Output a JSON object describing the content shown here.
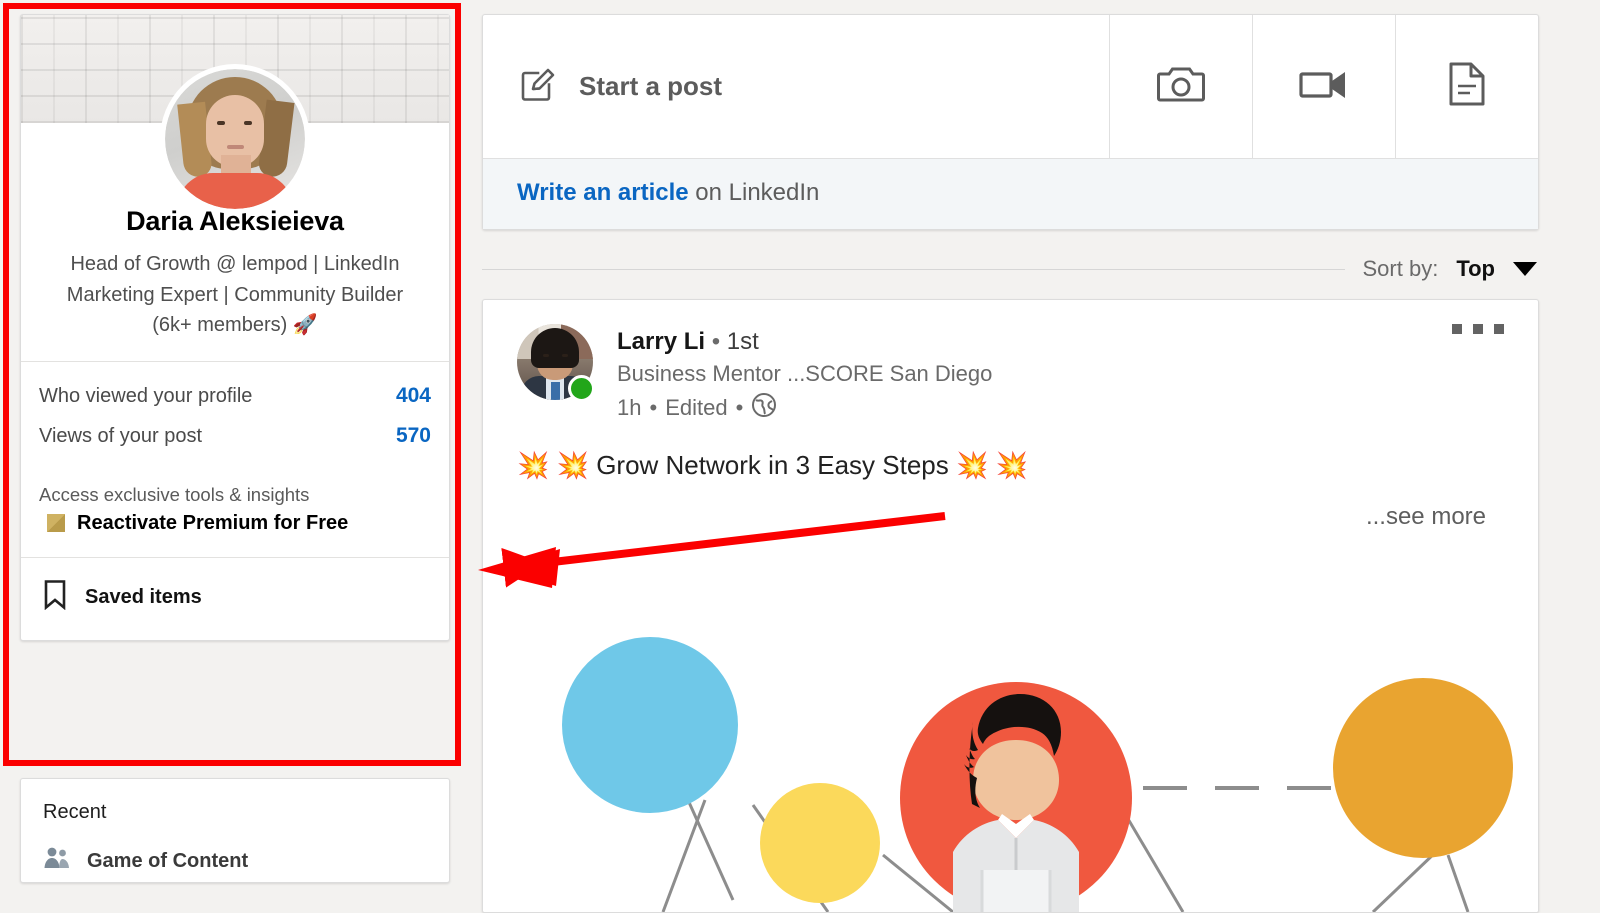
{
  "colors": {
    "accent": "#0a66c2",
    "annotation": "#fb0000",
    "presence": "#22a61a",
    "gold": "#c0a253",
    "illu_blue": "#6fc8e8",
    "illu_yellow": "#fbd95b",
    "illu_red": "#f0583f",
    "illu_orange": "#e9a430",
    "page_bg": "#f3f2f0"
  },
  "sidebar": {
    "profile": {
      "name": "Daria Aleksieieva",
      "headline": "Head of Growth @ lempod | LinkedIn Marketing Expert | Community Builder (6k+ members) 🚀",
      "avatar_alt": "profile-photo",
      "cover_alt": "white-brick-wall-cover"
    },
    "stats": [
      {
        "label": "Who viewed your profile",
        "value": "404"
      },
      {
        "label": "Views of your post",
        "value": "570"
      }
    ],
    "premium": {
      "line1": "Access exclusive tools & insights",
      "line2": "Reactivate Premium for Free",
      "icon": "premium-gold-square-icon"
    },
    "saved": {
      "label": "Saved items",
      "icon": "bookmark-icon"
    },
    "recent": {
      "title": "Recent",
      "items": [
        {
          "label": "Game of Content",
          "icon": "group-icon"
        }
      ]
    }
  },
  "composer": {
    "start_post_label": "Start a post",
    "start_post_icon": "pencil-square-icon",
    "buttons": [
      {
        "name": "photo-button",
        "icon": "camera-icon"
      },
      {
        "name": "video-button",
        "icon": "video-camera-icon"
      },
      {
        "name": "document-button",
        "icon": "document-icon"
      }
    ],
    "article_link": "Write an article",
    "article_suffix": " on LinkedIn"
  },
  "sortbar": {
    "label": "Sort by:",
    "value": "Top",
    "caret_icon": "chevron-down-icon"
  },
  "post": {
    "author_name": "Larry Li",
    "separator": "•",
    "degree": "1st",
    "subtitle": "Business Mentor ...SCORE San Diego",
    "time": "1h",
    "edited": "Edited",
    "visibility_icon": "globe-icon",
    "menu_icon": "ellipsis-icon",
    "body_text": "💥 💥  Grow Network in 3 Easy Steps 💥 💥",
    "see_more": "...see more",
    "image_alt": "network-illustration"
  },
  "annotations": {
    "highlight_box": "red-rectangle-around-profile-card",
    "arrow": "red-arrow-pointing-left-to-profile-card"
  }
}
